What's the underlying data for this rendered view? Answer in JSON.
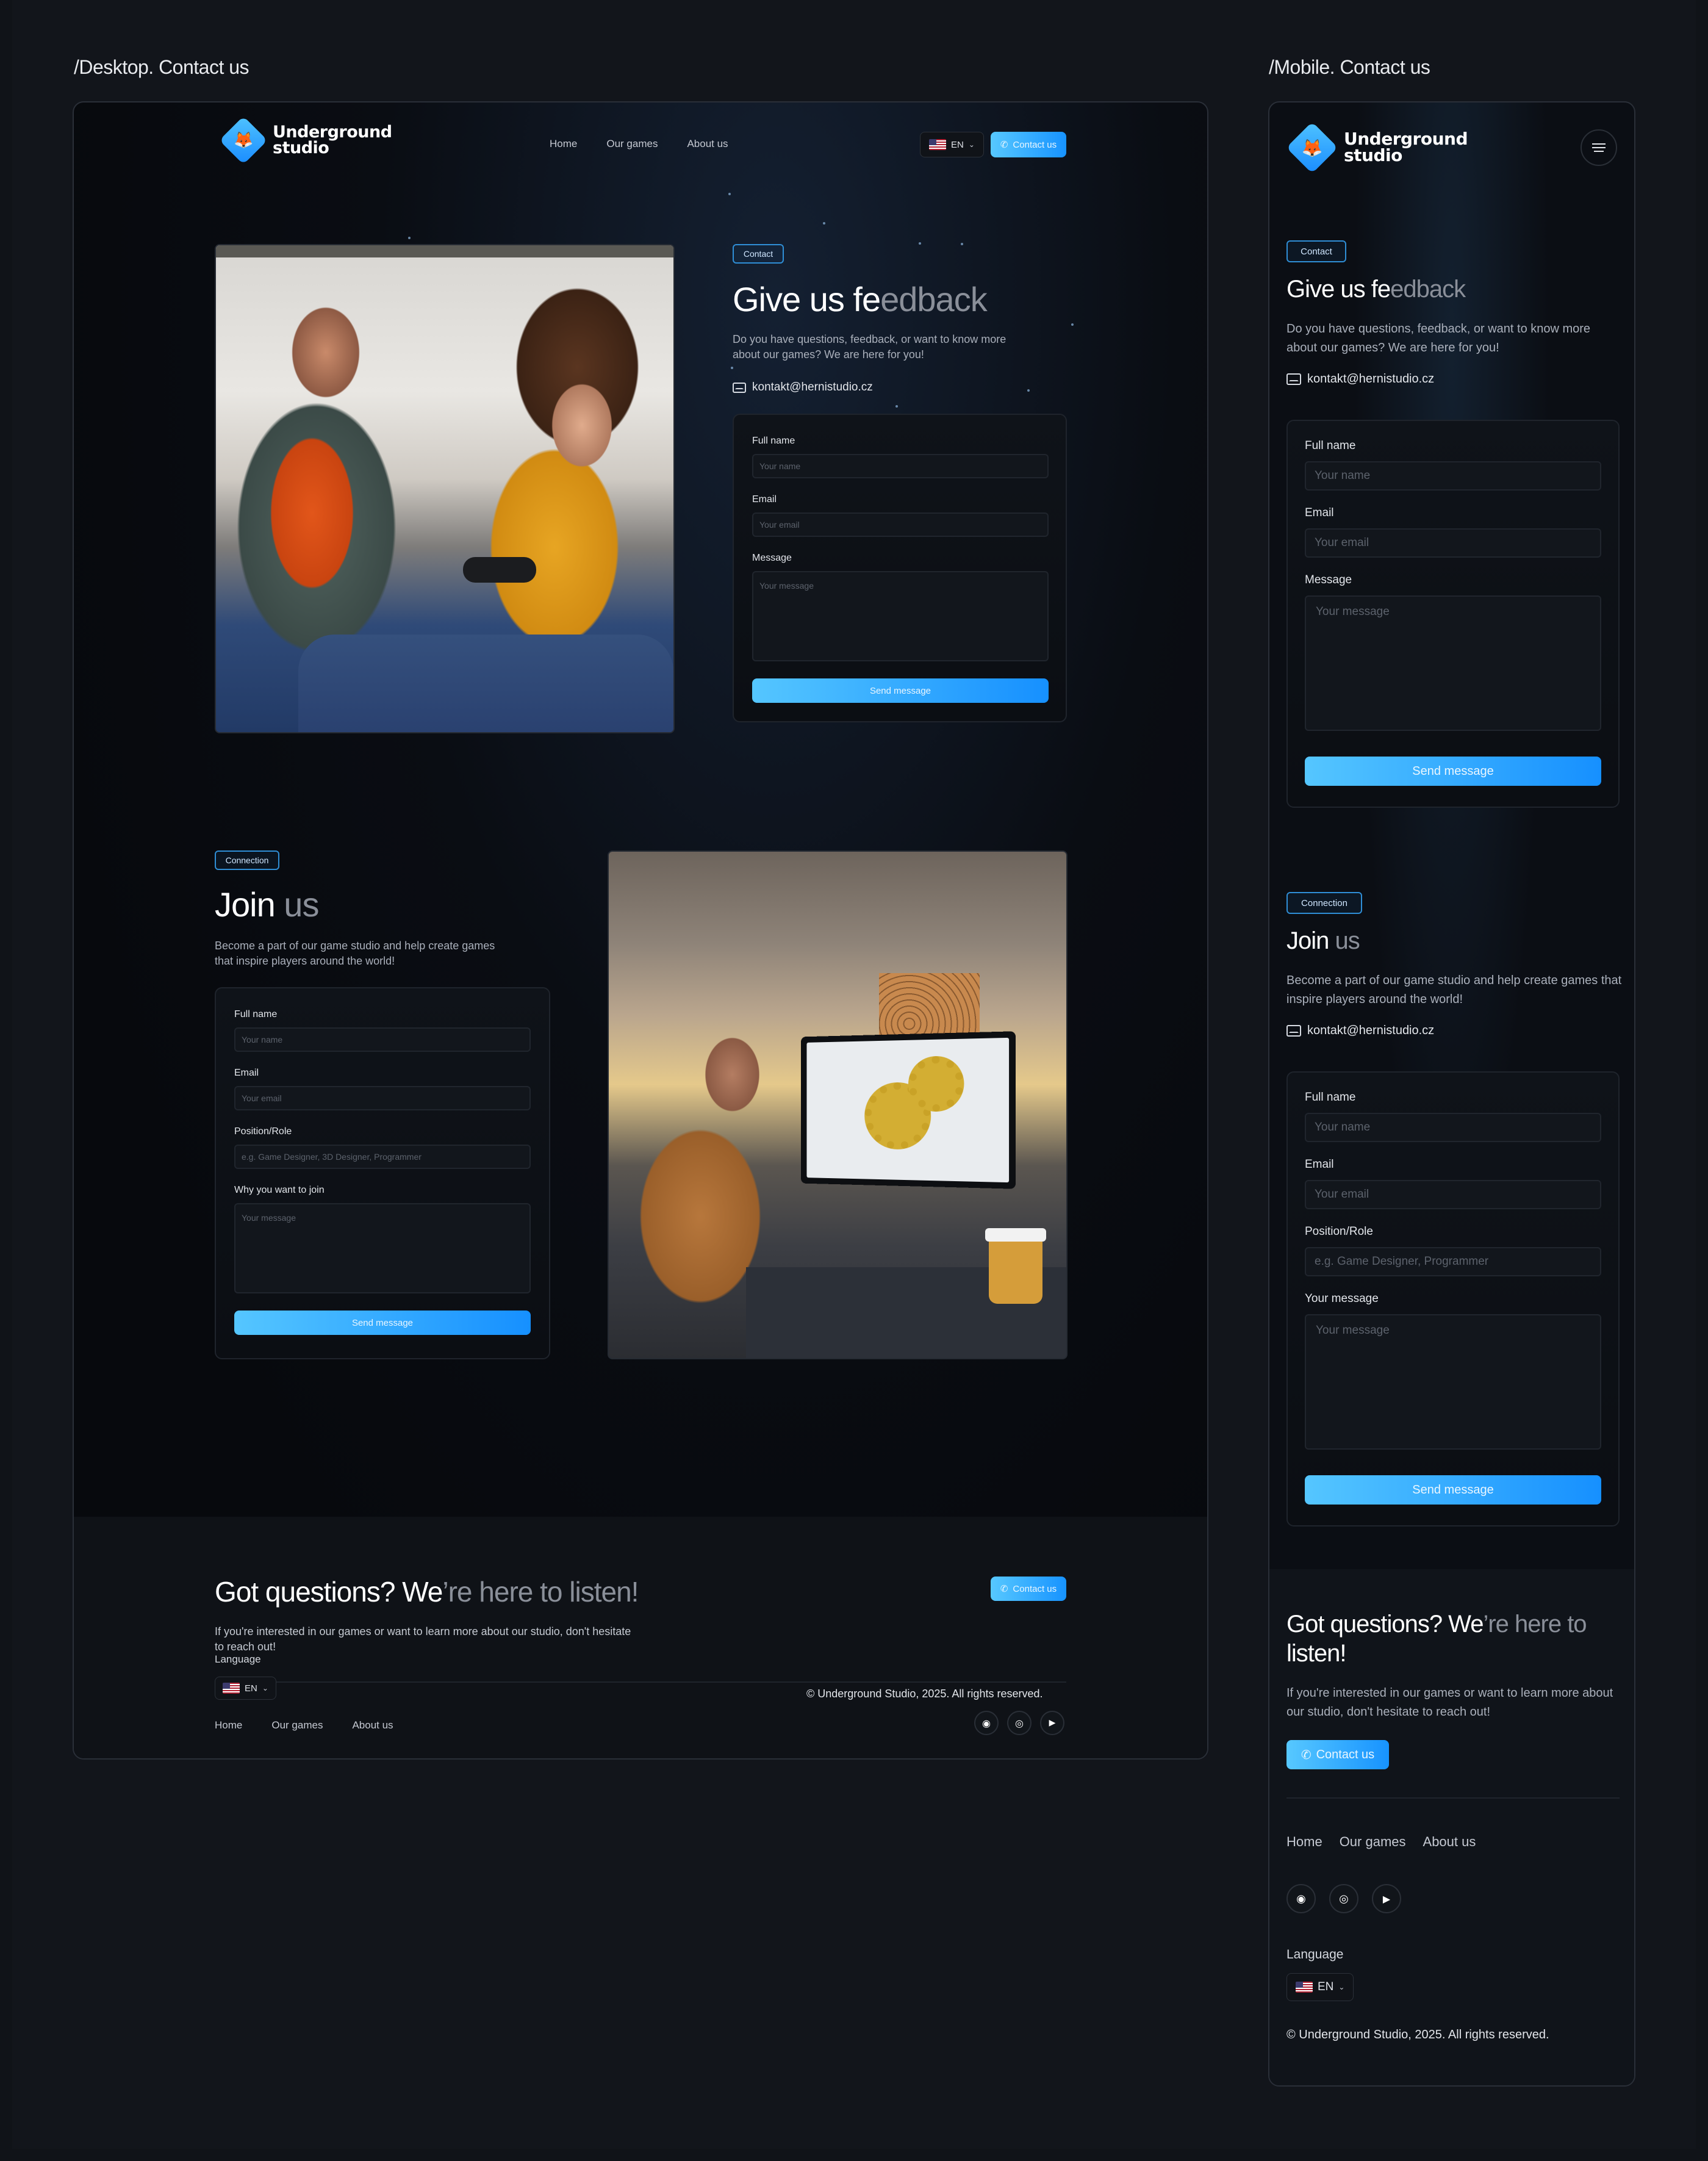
{
  "frames": {
    "desktop_title": "/Desktop. Contact us",
    "mobile_title": "/Mobile. Contact us"
  },
  "brand": {
    "line1": "Underground",
    "line2": "studio",
    "logo_glyph": "🦊",
    "accent_start": "#57c8ff",
    "accent_end": "#1793ff"
  },
  "nav": {
    "links": [
      "Home",
      "Our games",
      "About us"
    ],
    "language": "EN",
    "contact_button": "Contact us"
  },
  "feedback": {
    "tag": "Contact",
    "title_main": "Give us fe",
    "title_dim": "edback",
    "description": "Do you have questions, feedback, or want to know more about our games? We are here for you!",
    "email": "kontakt@hernistudio.cz",
    "form": {
      "name_label": "Full name",
      "name_placeholder": "Your name",
      "email_label": "Email",
      "email_placeholder": "Your email",
      "message_label": "Message",
      "message_placeholder": "Your message",
      "submit": "Send message"
    }
  },
  "join": {
    "tag": "Connection",
    "title_main": "Join ",
    "title_dim": "us",
    "description": "Become a part of our game studio and help create games that inspire players around the world!",
    "email": "kontakt@hernistudio.cz",
    "form": {
      "name_label": "Full name",
      "name_placeholder": "Your name",
      "email_label": "Email",
      "email_placeholder": "Your email",
      "role_label": "Position/Role",
      "role_placeholder_desktop": "e.g. Game Designer, 3D Designer, Programmer",
      "role_placeholder_mobile": "e.g. Game Designer, Programmer",
      "why_label": "Why you want to join",
      "message_label_mobile": "Your message",
      "message_placeholder": "Your message",
      "submit": "Send message"
    }
  },
  "cta": {
    "title_main": "Got questions? We",
    "title_dim": "’re here to listen!",
    "mobile_title_main": "Got questions? We",
    "mobile_title_dim": "’re here to",
    "mobile_title_last": "listen!",
    "description": "If you're interested in our games or want to learn more about our studio, don't hesitate to reach out!",
    "button": "Contact us"
  },
  "footer": {
    "links": [
      "Home",
      "Our games",
      "About us"
    ],
    "language_label": "Language",
    "language": "EN",
    "socials": [
      "discord-icon",
      "instagram-icon",
      "youtube-icon"
    ],
    "copyright": "© Underground Studio, 2025. All rights reserved."
  }
}
